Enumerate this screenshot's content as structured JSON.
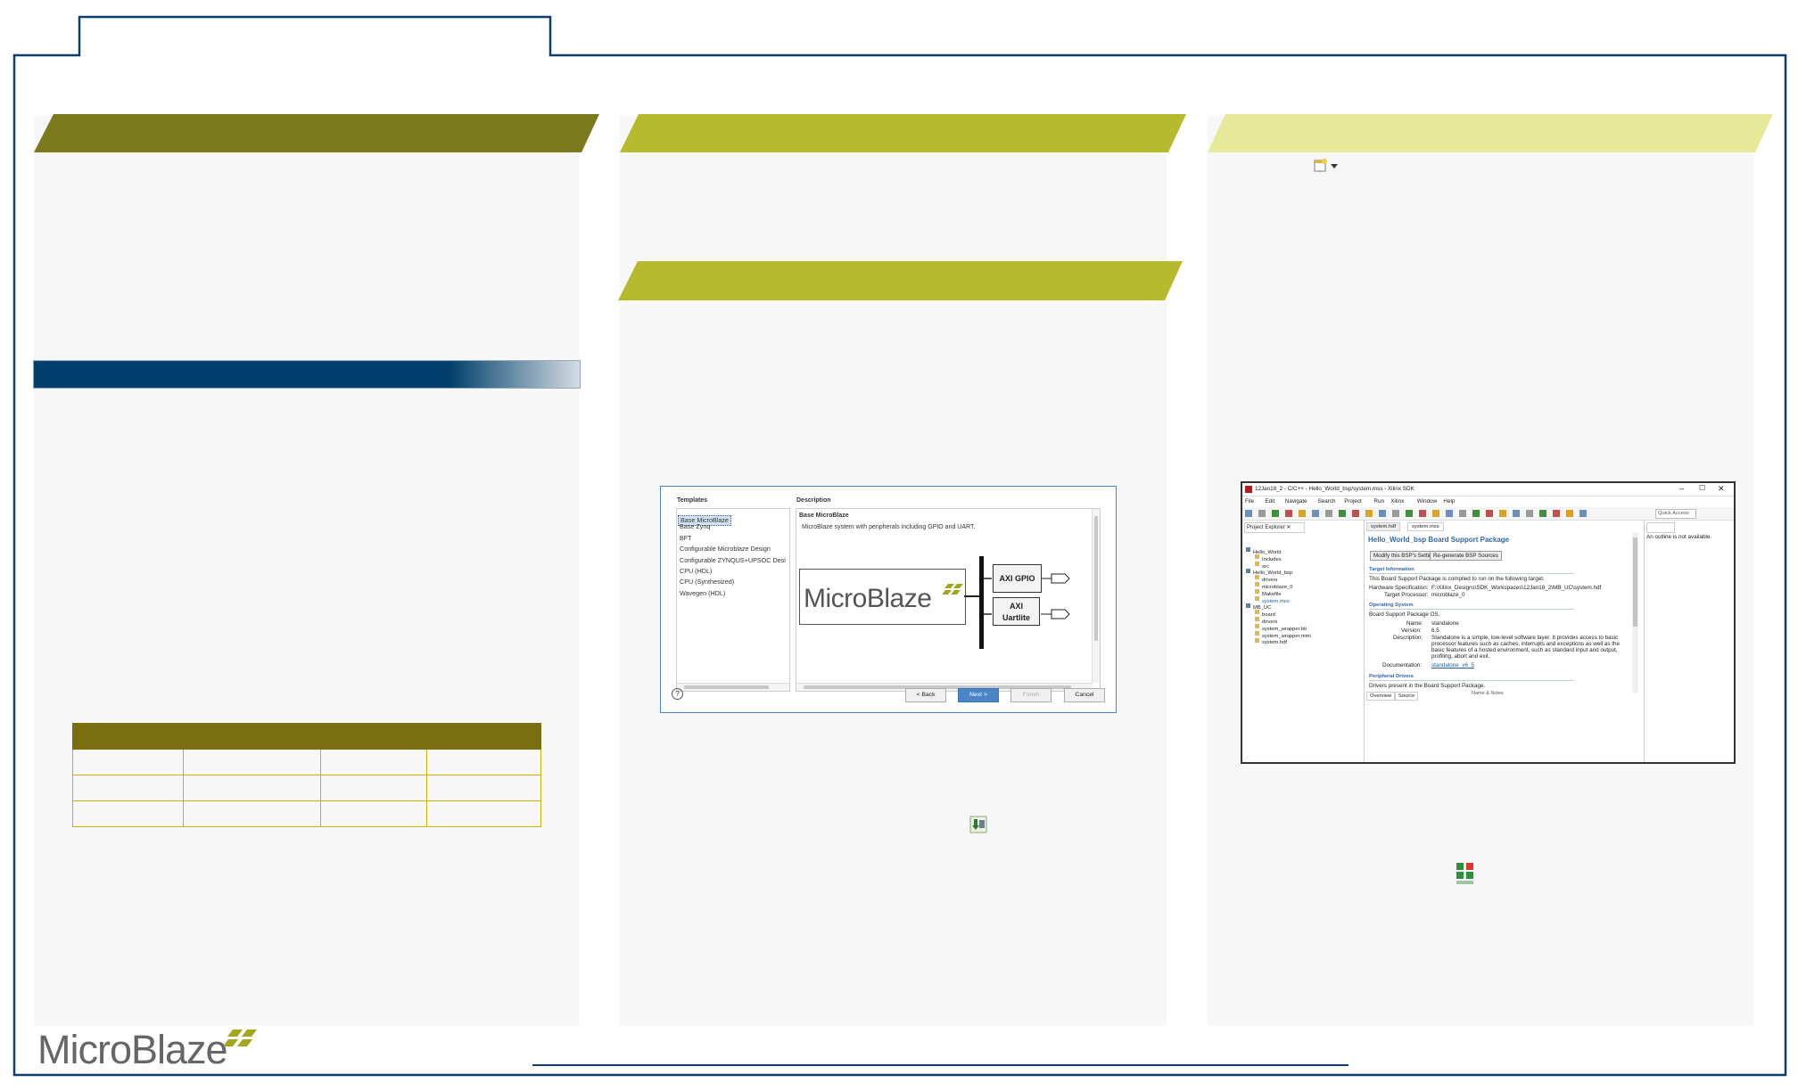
{
  "footer": {
    "logo_text": "MicroBlaze"
  },
  "wizard": {
    "templates_header": "Templates",
    "description_header": "Description",
    "templates": [
      "Base MicroBlaze",
      "Base Zynq",
      "BFT",
      "Configurable Microblaze Design",
      "Configurable ZYNQUS+UPSOC Desi",
      "CPU (HDL)",
      "CPU (Synthesized)",
      "Wavegen (HDL)"
    ],
    "selected_title": "Base MicroBlaze",
    "selected_desc": "MicroBlaze system with peripherals including GPIO and UART.",
    "diagram_logo": "MicroBlaze",
    "block_gpio": "AXI GPIO",
    "block_uart_1": "AXI",
    "block_uart_2": "Uartlite",
    "help_glyph": "?",
    "btn_back": "< Back",
    "btn_next": "Next >",
    "btn_finish": "Finish",
    "btn_cancel": "Cancel"
  },
  "sdk": {
    "window_title": "12Jan18_2 - C/C++ - Hello_World_bsp/system.mss - Xilinx SDK",
    "menu": [
      "File",
      "Edit",
      "Navigate",
      "Search",
      "Project",
      "Run",
      "Xilinx",
      "Window",
      "Help"
    ],
    "quick_access": "Quick Access",
    "explorer_tab": "Project Explorer",
    "tree": [
      "Hello_World",
      "Includes",
      "src",
      "Hello_World_bsp",
      "drivers",
      "microblaze_0",
      "Makefile",
      "system.mss",
      "MB_UC",
      "board",
      "drivers",
      "system_wrapper.bit",
      "system_wrapper.mmi",
      "system.hdf"
    ],
    "editor_tabs": [
      "system.hdf",
      "system.mss"
    ],
    "outline_tab": "",
    "outline_msg": "An outline is not available.",
    "bsp_title": "Hello_World_bsp Board Support Package",
    "btn_modify": "Modify this BSP's Settings",
    "btn_regen": "Re-generate BSP Sources",
    "target_info_hd": "Target Information",
    "target_info_txt": "This Board Support Package is compiled to run on the following target.",
    "hw_spec_label": "Hardware Specification:",
    "hw_spec_val": "F:\\Xilinx_Designs\\SDK_Workspaces\\12Jan18_2\\MB_UC\\system.hdf",
    "target_proc_label": "Target Processor:",
    "target_proc_val": "microblaze_0",
    "os_hd": "Operating System",
    "os_txt": "Board Support Package OS.",
    "name_label": "Name:",
    "name_val": "standalone",
    "version_label": "Version:",
    "version_val": "6.5",
    "desc_label": "Description:",
    "desc_val_1": "Standalone is a simple, low-level software layer. It provides access to basic",
    "desc_val_2": "processor features such as caches, interrupts and exceptions as well as the",
    "desc_val_3": "basic features of a hosted environment, such as standard input and output,",
    "desc_val_4": "profiling, abort and exit.",
    "doc_label": "Documentation:",
    "doc_val": "standalone_v6_5",
    "periph_hd": "Peripheral Drivers",
    "periph_txt": "Drivers present in the Board Support Package.",
    "periph_cut": "Name & Notes",
    "bottom_tabs": [
      "Overview",
      "Source"
    ]
  },
  "colors": {
    "olive_dark": "#7b7b1e",
    "olive_mid": "#b8ba2d",
    "olive_light": "#e6e89a",
    "navy": "#003f6b",
    "frame": "#0f3d6e",
    "logo_green": "#a2a61c"
  },
  "icons": [
    "new-bsp-dropdown-icon",
    "program-fpga-icon",
    "xilinx-tools-icon",
    "microblaze-logo"
  ]
}
